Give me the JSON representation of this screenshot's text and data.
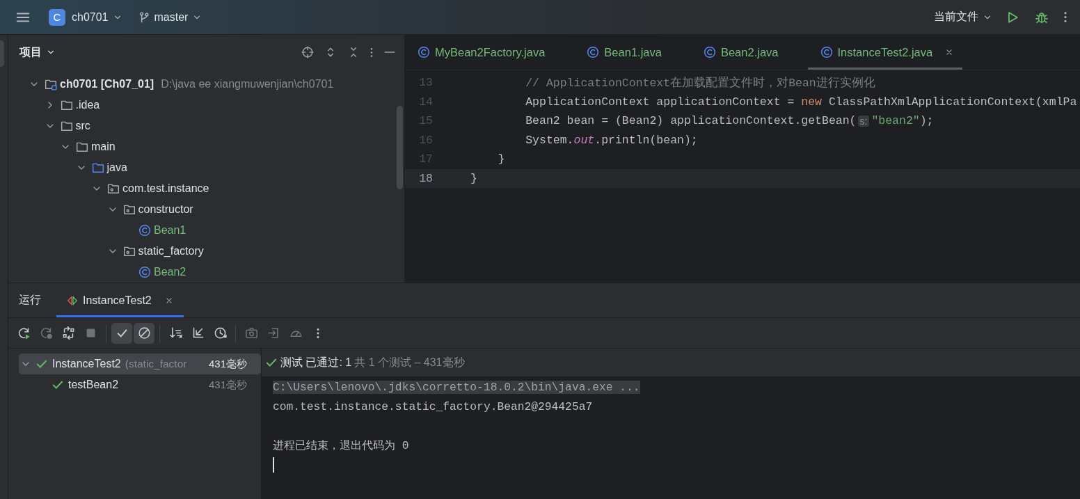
{
  "top_bar": {
    "project_badge": "C",
    "project": "ch0701",
    "branch": "master",
    "run_config": "当前文件"
  },
  "project_panel": {
    "title": "项目",
    "tree": [
      {
        "kind": "module",
        "label": "ch0701 [Ch07_01]",
        "path": "D:\\java ee xiangmuwenjian\\ch0701",
        "expanded": true,
        "children": [
          {
            "kind": "folder",
            "label": ".idea",
            "expanded": false
          },
          {
            "kind": "folder",
            "label": "src",
            "expanded": true,
            "children": [
              {
                "kind": "folder",
                "label": "main",
                "expanded": true,
                "children": [
                  {
                    "kind": "source-folder",
                    "label": "java",
                    "expanded": true,
                    "children": [
                      {
                        "kind": "package",
                        "label": "com.test.instance",
                        "expanded": true,
                        "children": [
                          {
                            "kind": "package",
                            "label": "constructor",
                            "expanded": true,
                            "children": [
                              {
                                "kind": "class",
                                "label": "Bean1"
                              }
                            ]
                          },
                          {
                            "kind": "package",
                            "label": "static_factory",
                            "expanded": true,
                            "children": [
                              {
                                "kind": "class",
                                "label": "Bean2"
                              }
                            ]
                          }
                        ]
                      }
                    ]
                  }
                ]
              }
            ]
          }
        ]
      }
    ]
  },
  "editor": {
    "tabs": [
      {
        "label": "MyBean2Factory.java",
        "selected": false
      },
      {
        "label": "Bean1.java",
        "selected": false
      },
      {
        "label": "Bean2.java",
        "selected": false
      },
      {
        "label": "InstanceTest2.java",
        "selected": true
      }
    ],
    "lines": [
      {
        "number": "13",
        "current": false,
        "tokens": [
          {
            "kind": "comment",
            "text": "        // ApplicationContext在加载配置文件时，对Bean进行实例化"
          }
        ]
      },
      {
        "number": "14",
        "current": false,
        "tokens": [
          {
            "kind": "plain",
            "text": "        ApplicationContext applicationContext = "
          },
          {
            "kind": "keyword",
            "text": "new"
          },
          {
            "kind": "plain",
            "text": " ClassPathXmlApplicationContext(xmlPa"
          }
        ]
      },
      {
        "number": "15",
        "current": false,
        "tokens": [
          {
            "kind": "plain",
            "text": "        Bean2 bean = (Bean2) applicationContext.getBean("
          },
          {
            "kind": "hint",
            "text": "s:"
          },
          {
            "kind": "string",
            "text": "\"bean2\""
          },
          {
            "kind": "plain",
            "text": ");"
          }
        ]
      },
      {
        "number": "16",
        "current": false,
        "tokens": [
          {
            "kind": "plain",
            "text": "        System."
          },
          {
            "kind": "field",
            "text": "out"
          },
          {
            "kind": "plain",
            "text": ".println(bean);"
          }
        ]
      },
      {
        "number": "17",
        "current": false,
        "tokens": [
          {
            "kind": "plain",
            "text": "    }"
          }
        ]
      },
      {
        "number": "18",
        "current": true,
        "tokens": [
          {
            "kind": "plain",
            "text": "}"
          }
        ]
      }
    ]
  },
  "run_panel": {
    "title": "运行",
    "tabs": [
      {
        "label": "InstanceTest2",
        "selected": true
      }
    ],
    "toolbar": [
      {
        "disabled": false,
        "selected": false
      },
      {
        "disabled": true,
        "selected": false
      },
      {
        "disabled": false,
        "selected": false
      },
      {
        "disabled": true,
        "selected": false
      },
      {
        "disabled": false,
        "selected": true
      },
      {
        "disabled": false,
        "selected": true
      },
      {
        "disabled": false,
        "selected": false
      },
      {
        "disabled": false,
        "selected": false
      },
      {
        "disabled": false,
        "selected": false
      },
      {
        "disabled": true,
        "selected": false
      },
      {
        "disabled": true,
        "selected": false
      },
      {
        "disabled": true,
        "selected": false
      },
      {
        "disabled": false,
        "selected": false
      }
    ],
    "tests": [
      {
        "name": "InstanceTest2",
        "detail": "(static_factor",
        "time": "431毫秒",
        "passed": true,
        "expanded": true,
        "selected": true,
        "children": [
          {
            "name": "testBean2",
            "time": "431毫秒",
            "passed": true,
            "selected": false
          }
        ]
      }
    ],
    "status": {
      "passed": true,
      "result": "测试 已通过: 1",
      "summary": "共 1 个测试 – 431毫秒"
    },
    "console": {
      "caret": true,
      "lines": [
        {
          "kind": "command",
          "text": "C:\\Users\\lenovo\\.jdks\\corretto-18.0.2\\bin\\java.exe ..."
        },
        {
          "kind": "output",
          "text": "com.test.instance.static_factory.Bean2@294425a7"
        },
        {
          "kind": "blank"
        },
        {
          "kind": "output",
          "text": "进程已结束，退出代码为 0"
        }
      ]
    }
  }
}
